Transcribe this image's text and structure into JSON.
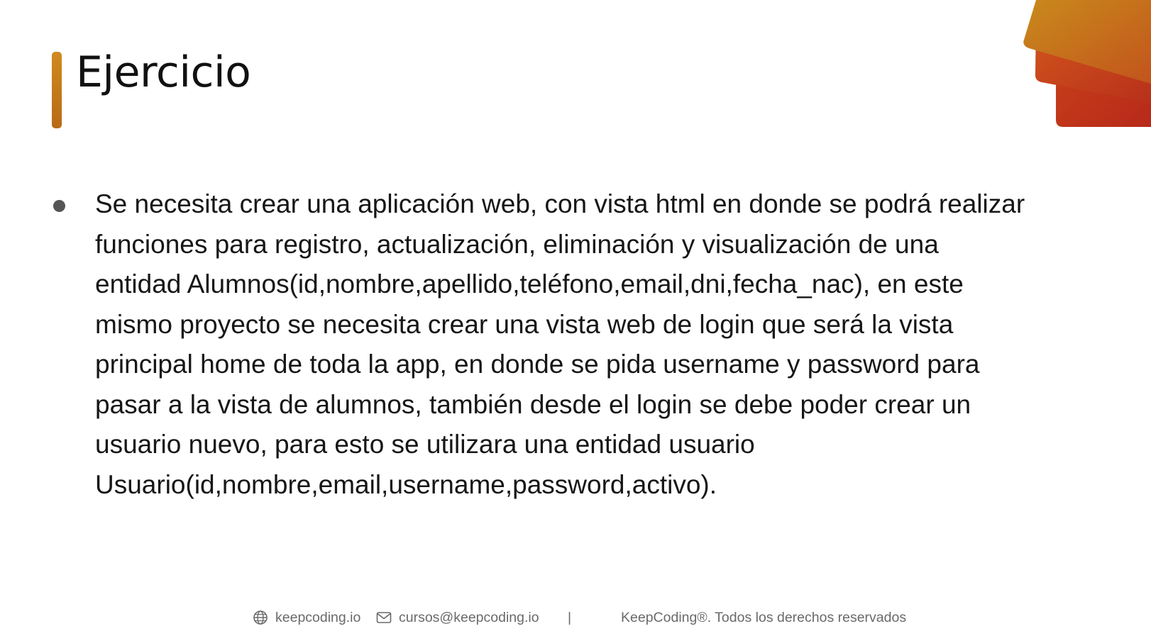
{
  "slide": {
    "title": "Ejercicio",
    "bullets": [
      {
        "text": "Se necesita crear una aplicación web, con vista html en donde se podrá realizar\nfunciones para registro, actualización, eliminación y visualización de una\nentidad Alumnos(id,nombre,apellido,teléfono,email,dni,fecha_nac), en este\nmismo proyecto se necesita crear una vista web de login que será la vista\nprincipal home de toda la app, en donde se pida username y password para\npasar a la vista de alumnos, también desde el login se debe poder crear un\nusuario nuevo, para esto se utilizara una entidad usuario\nUsuario(id,nombre,email,username,password,activo)."
      }
    ]
  },
  "footer": {
    "website": "keepcoding.io",
    "website_icon": "globe-icon",
    "email": "cursos@keepcoding.io",
    "email_icon": "envelope-icon",
    "separator": "|",
    "copyright": "KeepCoding®. Todos los derechos reservados"
  },
  "colors": {
    "accent_bar": "#c47a1a",
    "corner_orange": "#d7831f",
    "corner_red": "#c23518",
    "bullet": "#555555",
    "footer_text": "#6a6a6a"
  }
}
